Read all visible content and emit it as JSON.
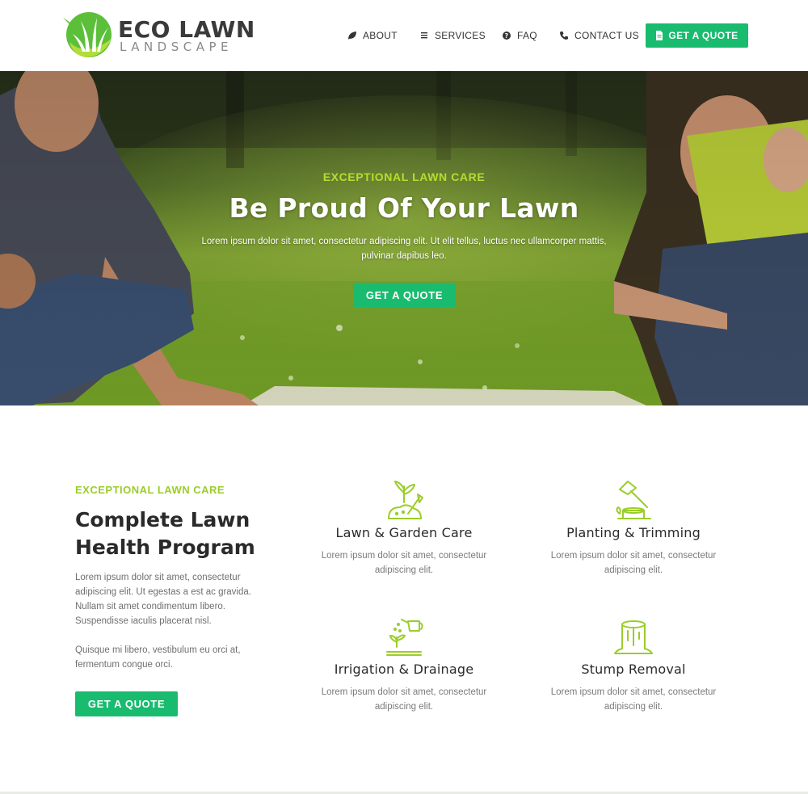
{
  "brand": {
    "name": "ECO LAWN",
    "tagline": "LANDSCAPE",
    "colors": {
      "primary_green": "#19bb6f",
      "lime_accent": "#9bcd2a",
      "logo_green": "#5cbf3a"
    }
  },
  "nav": {
    "items": [
      {
        "label": "ABOUT",
        "icon": "leaf-icon"
      },
      {
        "label": "SERVICES",
        "icon": "list-icon"
      },
      {
        "label": "FAQ",
        "icon": "question-circle-icon"
      },
      {
        "label": "CONTACT US",
        "icon": "phone-icon"
      }
    ],
    "cta": {
      "label": "GET A QUOTE",
      "icon": "document-icon"
    }
  },
  "hero": {
    "kicker": "EXCEPTIONAL LAWN CARE",
    "title": "Be Proud Of Your Lawn",
    "text": "Lorem ipsum dolor sit amet, consectetur adipiscing elit. Ut elit tellus, luctus nec ullamcorper mattis, pulvinar dapibus leo.",
    "button": "GET A QUOTE"
  },
  "services": {
    "kicker": "EXCEPTIONAL LAWN CARE",
    "title": "Complete Lawn Health Program",
    "paragraph1": "Lorem ipsum dolor sit amet, consectetur adipiscing elit. Ut egestas a est ac gravida. Nullam sit amet condimentum libero. Suspendisse iaculis placerat nisl.",
    "paragraph2": "Quisque mi libero, vestibulum eu orci at, fermentum congue orci.",
    "button": "GET A QUOTE",
    "cards": [
      {
        "title": "Lawn & Garden Care",
        "text": "Lorem ipsum dolor sit amet, consectetur adipiscing elit.",
        "icon": "plant-shovel-icon"
      },
      {
        "title": "Planting & Trimming",
        "text": "Lorem ipsum dolor sit amet, consectetur adipiscing elit.",
        "icon": "axe-stump-icon"
      },
      {
        "title": "Irrigation & Drainage",
        "text": "Lorem ipsum dolor sit amet, consectetur adipiscing elit.",
        "icon": "watering-can-icon"
      },
      {
        "title": "Stump Removal",
        "text": "Lorem ipsum dolor sit amet, consectetur adipiscing elit.",
        "icon": "tree-stump-icon"
      }
    ]
  }
}
